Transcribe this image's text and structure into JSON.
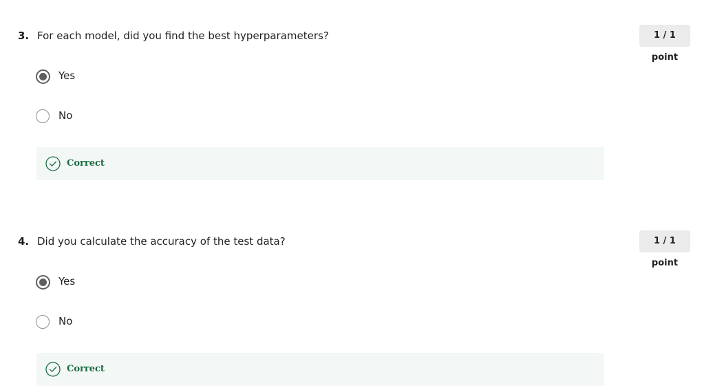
{
  "questions": [
    {
      "number": "3.",
      "text": "For each model, did you find the best hyperparameters?",
      "points": "1 / 1 point",
      "options": [
        {
          "label": "Yes",
          "selected": true
        },
        {
          "label": "No",
          "selected": false
        }
      ],
      "feedback": {
        "status_icon": "check-circle-icon",
        "label": "Correct",
        "color": "#1a6b42"
      }
    },
    {
      "number": "4.",
      "text": "Did you calculate the accuracy of the test data?",
      "points": "1 / 1 point",
      "options": [
        {
          "label": "Yes",
          "selected": true
        },
        {
          "label": "No",
          "selected": false
        }
      ],
      "feedback": {
        "status_icon": "check-circle-icon",
        "label": "Correct",
        "color": "#1a6b42"
      }
    }
  ]
}
